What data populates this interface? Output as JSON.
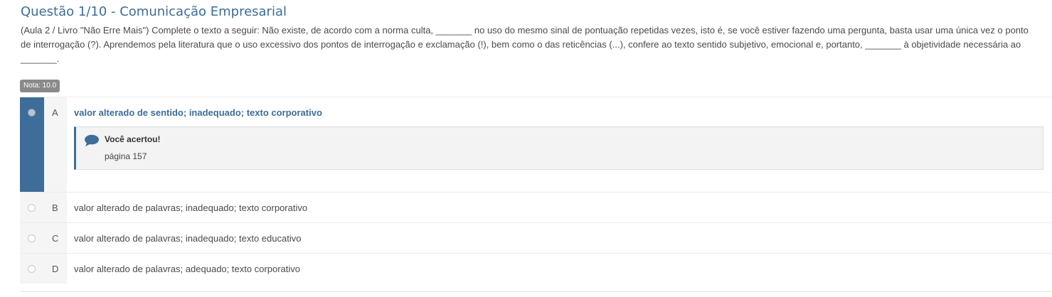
{
  "question": {
    "title": "Questão 1/10 - Comunicação Empresarial",
    "text": "(Aula 2 / Livro \"Não Erre Mais\")  Complete o texto a seguir:  Não existe, de acordo com a norma culta, _______ no uso do mesmo sinal de pontuação repetidas vezes, isto é, se você estiver fazendo uma pergunta, basta usar uma única vez o ponto de interrogação (?). Aprendemos pela literatura que o uso excessivo dos pontos de interrogação e exclamação (!), bem como o das reticências (...), confere ao texto sentido subjetivo, emocional e, portanto, _______ à objetividade necessária ao _______.",
    "grade": "Nota: 10.0"
  },
  "options": [
    {
      "letter": "A",
      "text": "valor alterado de sentido; inadequado; texto corporativo",
      "selected": true
    },
    {
      "letter": "B",
      "text": "valor alterado de palavras; inadequado; texto corporativo",
      "selected": false
    },
    {
      "letter": "C",
      "text": "valor alterado de palavras; inadequado; texto educativo",
      "selected": false
    },
    {
      "letter": "D",
      "text": "valor alterado de palavras; adequado; texto corporativo",
      "selected": false
    }
  ],
  "feedback": {
    "icon": "comment-icon",
    "title": "Você acertou!",
    "body": "página 157"
  },
  "colors": {
    "accent": "#3d6d98",
    "badge": "#8a8a8a"
  }
}
